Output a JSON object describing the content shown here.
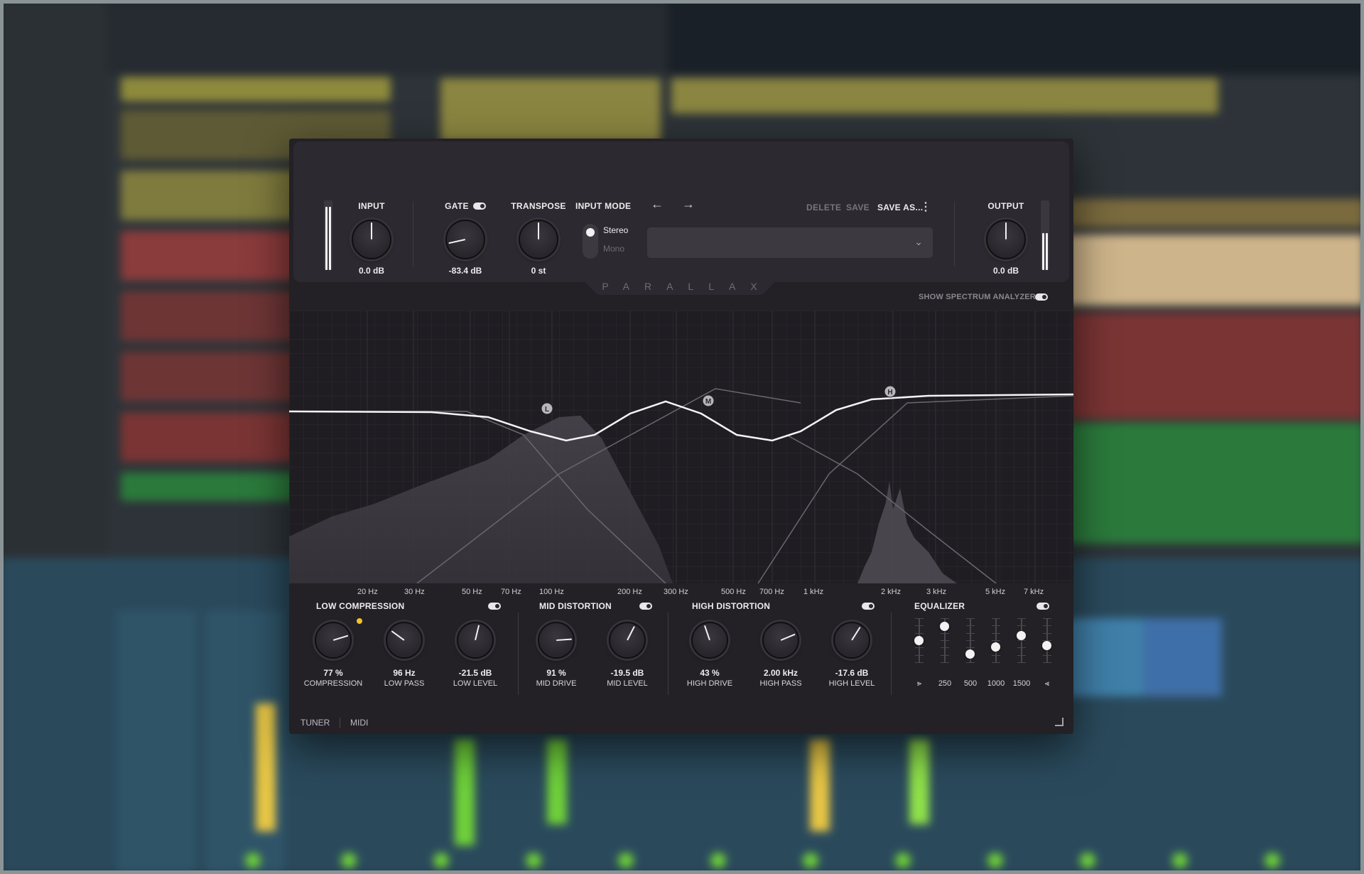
{
  "plugin": {
    "brand": "PARALLAX",
    "input": {
      "label": "INPUT",
      "value": "0.0 dB",
      "level": 0.95
    },
    "gate": {
      "label": "GATE",
      "value": "-83.4 dB",
      "enabled": true
    },
    "transpose": {
      "label": "TRANSPOSE",
      "value": "0 st"
    },
    "input_mode": {
      "label": "INPUT MODE",
      "options": [
        "Stereo",
        "Mono"
      ],
      "selected": "Stereo"
    },
    "preset": {
      "prev_icon": "arrow-left-icon",
      "next_icon": "arrow-right-icon",
      "delete_label": "DELETE",
      "save_label": "SAVE",
      "save_as_label": "SAVE AS...",
      "menu_icon": "more-vertical-icon",
      "selected": ""
    },
    "output": {
      "label": "OUTPUT",
      "value": "0.0 dB",
      "level": 0.55
    },
    "spectrum_analyzer": {
      "label": "SHOW SPECTRUM ANALYZER",
      "enabled": true
    },
    "eq_graph": {
      "nodes": [
        {
          "id": "low",
          "label": "L"
        },
        {
          "id": "mid",
          "label": "M"
        },
        {
          "id": "high",
          "label": "H"
        }
      ],
      "freq_labels": [
        "20 Hz",
        "30 Hz",
        "50 Hz",
        "70 Hz",
        "100 Hz",
        "200 Hz",
        "300 Hz",
        "500 Hz",
        "700 Hz",
        "1 kHz",
        "2 kHz",
        "3 kHz",
        "5 kHz",
        "7 kHz"
      ]
    },
    "low_compression": {
      "title": "LOW COMPRESSION",
      "enabled": true,
      "knobs": [
        {
          "value": "77 %",
          "label": "COMPRESSION",
          "amount": 0.77
        },
        {
          "value": "96 Hz",
          "label": "LOW PASS",
          "amount": 0.3
        },
        {
          "value": "-21.5 dB",
          "label": "LOW LEVEL",
          "amount": 0.55
        }
      ]
    },
    "mid_distortion": {
      "title": "MID DISTORTION",
      "enabled": true,
      "knobs": [
        {
          "value": "91 %",
          "label": "MID DRIVE",
          "amount": 0.82
        },
        {
          "value": "-19.5 dB",
          "label": "MID LEVEL",
          "amount": 0.6
        }
      ]
    },
    "high_distortion": {
      "title": "HIGH DISTORTION",
      "enabled": true,
      "knobs": [
        {
          "value": "43 %",
          "label": "HIGH DRIVE",
          "amount": 0.43
        },
        {
          "value": "2.00 kHz",
          "label": "HIGH PASS",
          "amount": 0.75
        },
        {
          "value": "-17.6 dB",
          "label": "HIGH LEVEL",
          "amount": 0.62
        }
      ]
    },
    "equalizer": {
      "title": "EQUALIZER",
      "enabled": true,
      "bands": [
        {
          "label": "",
          "icon": "low-shelf-icon",
          "level": 0.5
        },
        {
          "label": "250",
          "level": 0.82
        },
        {
          "label": "500",
          "level": 0.2
        },
        {
          "label": "1000",
          "level": 0.35
        },
        {
          "label": "1500",
          "level": 0.62
        },
        {
          "label": "",
          "icon": "high-shelf-icon",
          "level": 0.38
        }
      ]
    },
    "footer": {
      "tuner_label": "TUNER",
      "midi_label": "MIDI",
      "resize_icon": "resize-icon"
    },
    "colors": {
      "accent": "#f2c12e",
      "panel": "#2c2a30",
      "background": "#232126"
    }
  }
}
